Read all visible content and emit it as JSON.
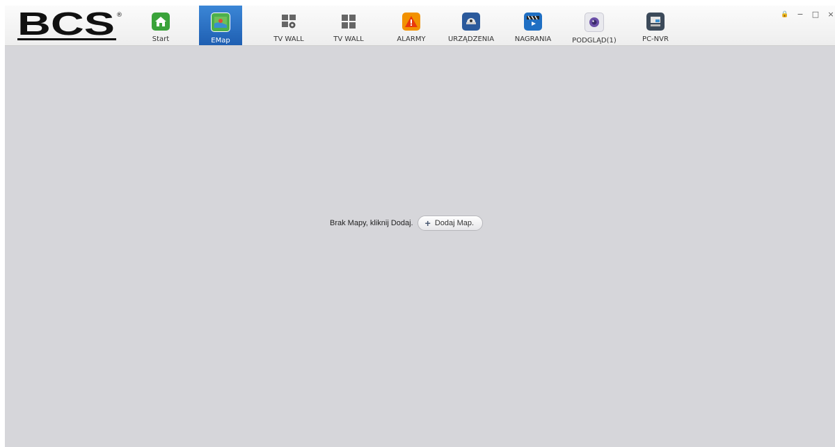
{
  "app": {
    "logo_text": "BCS"
  },
  "nav": {
    "tabs": [
      {
        "label": "Start",
        "icon": "home-icon",
        "color": "#3aa33a"
      },
      {
        "label": "EMap",
        "icon": "map-icon",
        "color": "#3d9e4a",
        "active": true
      },
      {
        "label": "TV WALL",
        "icon": "tv-wall-settings-icon",
        "color": "#555555"
      },
      {
        "label": "TV WALL",
        "icon": "tv-wall-icon",
        "color": "#555555"
      },
      {
        "label": "ALARMY",
        "icon": "alarm-warning-icon",
        "color": "#f29100"
      },
      {
        "label": "URZĄDZENIA",
        "icon": "device-camera-icon",
        "color": "#2b5a9c"
      },
      {
        "label": "NAGRANIA",
        "icon": "recording-clapper-icon",
        "color": "#1f6fc3"
      },
      {
        "label": "PODGLĄD(1)",
        "icon": "preview-lens-icon",
        "color": "#6b4fa8"
      },
      {
        "label": "PC-NVR",
        "icon": "pc-nvr-icon",
        "color": "#3c4a5a"
      }
    ]
  },
  "window_controls": {
    "lock": "🔒",
    "minimize": "−",
    "maximize": "□",
    "close": "×"
  },
  "main": {
    "empty_message": "Brak Mapy, kliknij Dodaj.",
    "add_button_label": "Dodaj Map."
  },
  "colors": {
    "accent": "#2a70c4",
    "background": "#d6d6da"
  }
}
